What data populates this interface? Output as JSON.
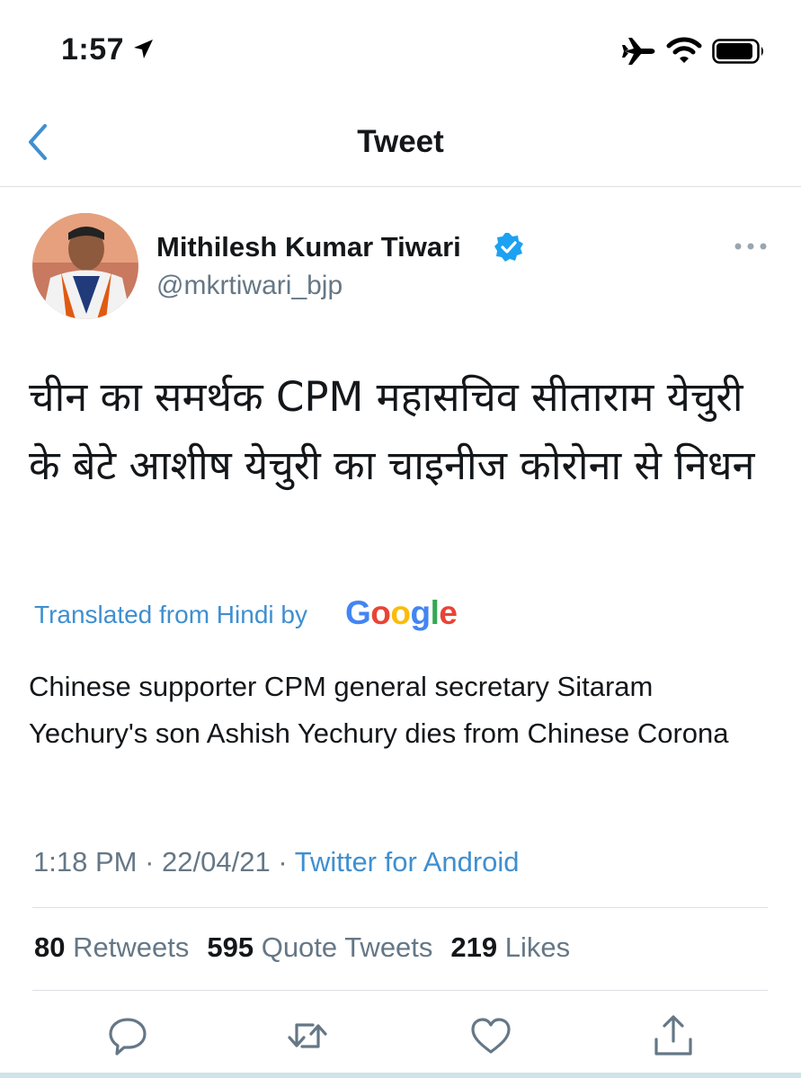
{
  "status_bar": {
    "time": "1:57"
  },
  "nav": {
    "title": "Tweet"
  },
  "author": {
    "name": "Mithilesh Kumar Tiwari",
    "handle": "@mkrtiwari_bjp",
    "verified": true
  },
  "tweet": {
    "text": "चीन का समर्थक CPM महासचिव सीताराम येचुरी के बेटे आशीष येचुरी का चाइनीज कोरोना से निधन",
    "translated_label": "Translated from Hindi by",
    "translator": "Google",
    "translation": "Chinese supporter CPM general secretary Sitaram Yechury's son Ashish Yechury dies from Chinese Corona",
    "time": "1:18 PM",
    "date": "22/04/21",
    "source": "Twitter for Android",
    "separator": "·"
  },
  "stats": {
    "retweets_count": "80",
    "retweets_label": "Retweets",
    "quotes_count": "595",
    "quotes_label": "Quote Tweets",
    "likes_count": "219",
    "likes_label": "Likes"
  },
  "colors": {
    "link": "#3f8fd0",
    "muted": "#657786",
    "text": "#14171a",
    "verified": "#1da1f2"
  },
  "icons": [
    "location-arrow-icon",
    "airplane-icon",
    "wifi-icon",
    "battery-icon",
    "back-chevron-icon",
    "verified-badge-icon",
    "more-icon",
    "reply-icon",
    "retweet-icon",
    "like-icon",
    "share-icon"
  ]
}
